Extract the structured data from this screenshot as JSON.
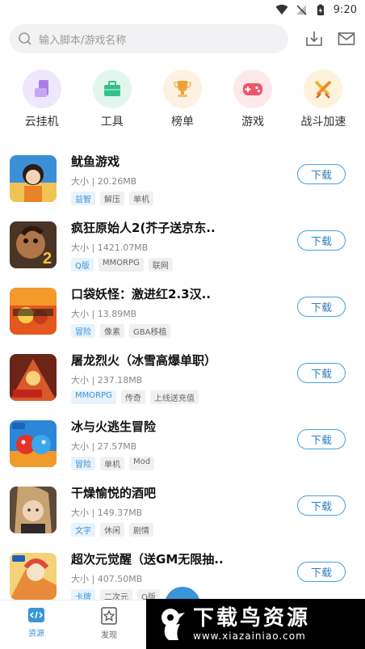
{
  "status": {
    "time": "9:20"
  },
  "search": {
    "placeholder": "输入脚本/游戏名称"
  },
  "nav": [
    {
      "label": "云挂机",
      "icon": "phone-icon",
      "bg": "#efe7fb",
      "color": "#a77ee6"
    },
    {
      "label": "工具",
      "icon": "toolbox-icon",
      "bg": "#e3f6ee",
      "color": "#33c08a"
    },
    {
      "label": "榜单",
      "icon": "trophy-icon",
      "bg": "#fdf1e2",
      "color": "#f0a23a"
    },
    {
      "label": "游戏",
      "icon": "gamepad-icon",
      "bg": "#fde8ea",
      "color": "#f0566a"
    },
    {
      "label": "战斗加速",
      "icon": "swords-icon",
      "bg": "#fdf3dc",
      "color": "#f2b428"
    }
  ],
  "games": [
    {
      "title": "鱿鱼游戏",
      "size": "大小 | 20.26MB",
      "tags": [
        "益智",
        "解压",
        "单机"
      ],
      "download": "下载",
      "thumb": "#e2a441"
    },
    {
      "title": "疯狂原始人2(芥子送京东..",
      "size": "大小 | 1421.07MB",
      "tags": [
        "Q版",
        "MMORPG",
        "联网"
      ],
      "download": "下载",
      "thumb": "#7a5135"
    },
    {
      "title": "口袋妖怪：激进红2.3汉..",
      "size": "大小 | 13.89MB",
      "tags": [
        "冒险",
        "像素",
        "GBA移植"
      ],
      "download": "下载",
      "thumb": "#e4571f"
    },
    {
      "title": "屠龙烈火（冰雪高爆单职）",
      "size": "大小 | 237.18MB",
      "tags": [
        "MMORPG",
        "传奇",
        "上线送充值"
      ],
      "download": "下载",
      "thumb": "#b9452a"
    },
    {
      "title": "冰与火逃生冒险",
      "size": "大小 | 27.57MB",
      "tags": [
        "冒险",
        "单机",
        "Mod"
      ],
      "download": "下载",
      "thumb": "#2c86d8"
    },
    {
      "title": "干燥愉悦的酒吧",
      "size": "大小 | 149.37MB",
      "tags": [
        "文字",
        "休闲",
        "剧情"
      ],
      "download": "下载",
      "thumb": "#8c6a4c"
    },
    {
      "title": "超次元觉醒（送GM无限抽..",
      "size": "大小 | 407.50MB",
      "tags": [
        "卡牌",
        "二次元",
        "Q版"
      ],
      "download": "下载",
      "thumb": "#e7b64a"
    }
  ],
  "tabs": [
    {
      "label": "资源",
      "active": true
    },
    {
      "label": "发现",
      "active": false
    }
  ],
  "watermark": {
    "main": "下载鸟资源",
    "url": "www.xiazainiao.com"
  }
}
